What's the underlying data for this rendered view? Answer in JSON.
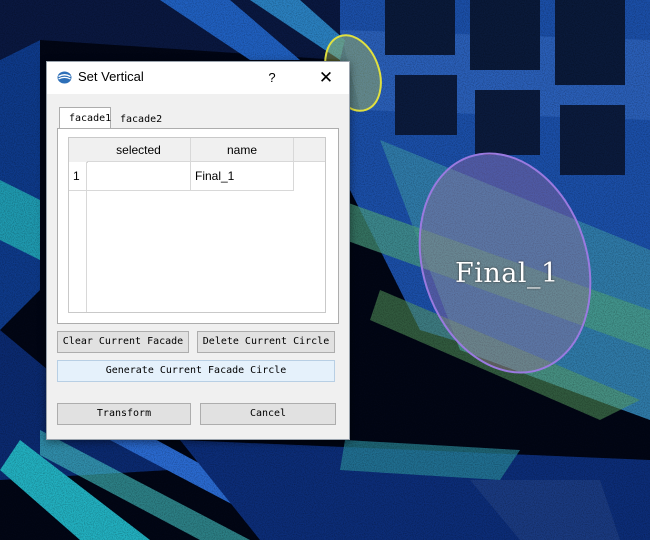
{
  "viewport": {
    "label": "Final_1",
    "colors": {
      "background": "#000000",
      "highlight": "#9a7ae0",
      "marker": "#e0e040"
    }
  },
  "dialog": {
    "icon": "app-logo-icon",
    "title": "Set Vertical",
    "help_label": "?",
    "close_label": "✕",
    "tabs": [
      {
        "label": "facade1",
        "active": true
      },
      {
        "label": "facade2",
        "active": false
      }
    ],
    "table": {
      "headers": [
        "selected",
        "name",
        ""
      ],
      "rows": [
        {
          "index": "1",
          "selected": "",
          "name": "Final_1"
        }
      ]
    },
    "buttons": {
      "clear": "Clear Current Facade",
      "delete": "Delete Current Circle",
      "generate": "Generate Current Facade Circle",
      "transform": "Transform",
      "cancel": "Cancel"
    }
  }
}
